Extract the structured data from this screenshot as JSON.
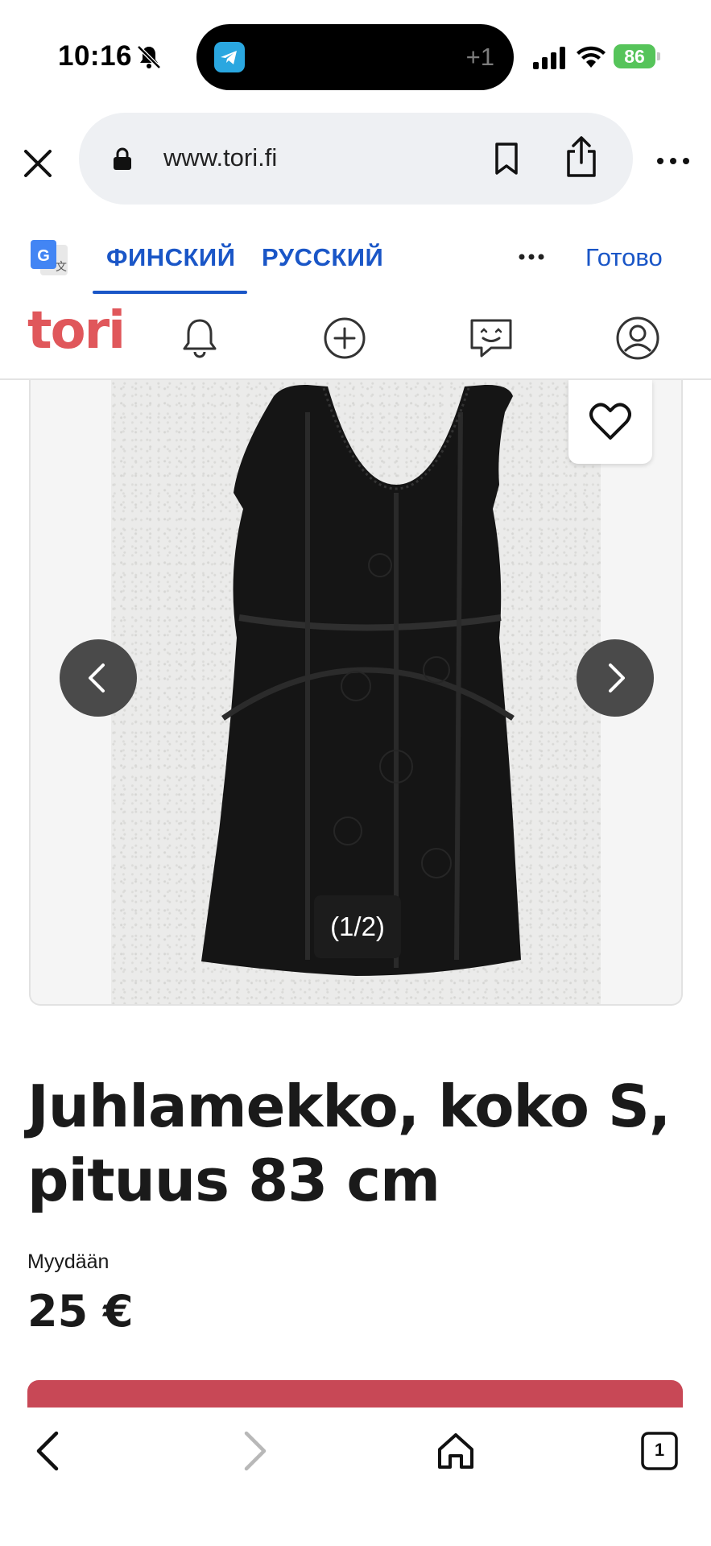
{
  "status_bar": {
    "time": "10:16",
    "notification_count": "+1",
    "battery": "86"
  },
  "browser": {
    "url": "www.tori.fi"
  },
  "translate_bar": {
    "source_language": "ФИНСКИЙ",
    "target_language": "РУССКИЙ",
    "done_label": "Готово"
  },
  "site": {
    "logo": "tori"
  },
  "listing": {
    "image_counter": "(1/2)",
    "title": "Juhlamekko, koko S, pituus 83 cm",
    "sale_type": "Myydään",
    "price": "25 €"
  },
  "toolbar": {
    "tab_count": "1"
  },
  "colors": {
    "brand": "#e0575b",
    "accent_blue": "#1a56c7",
    "cta": "#c84856"
  }
}
